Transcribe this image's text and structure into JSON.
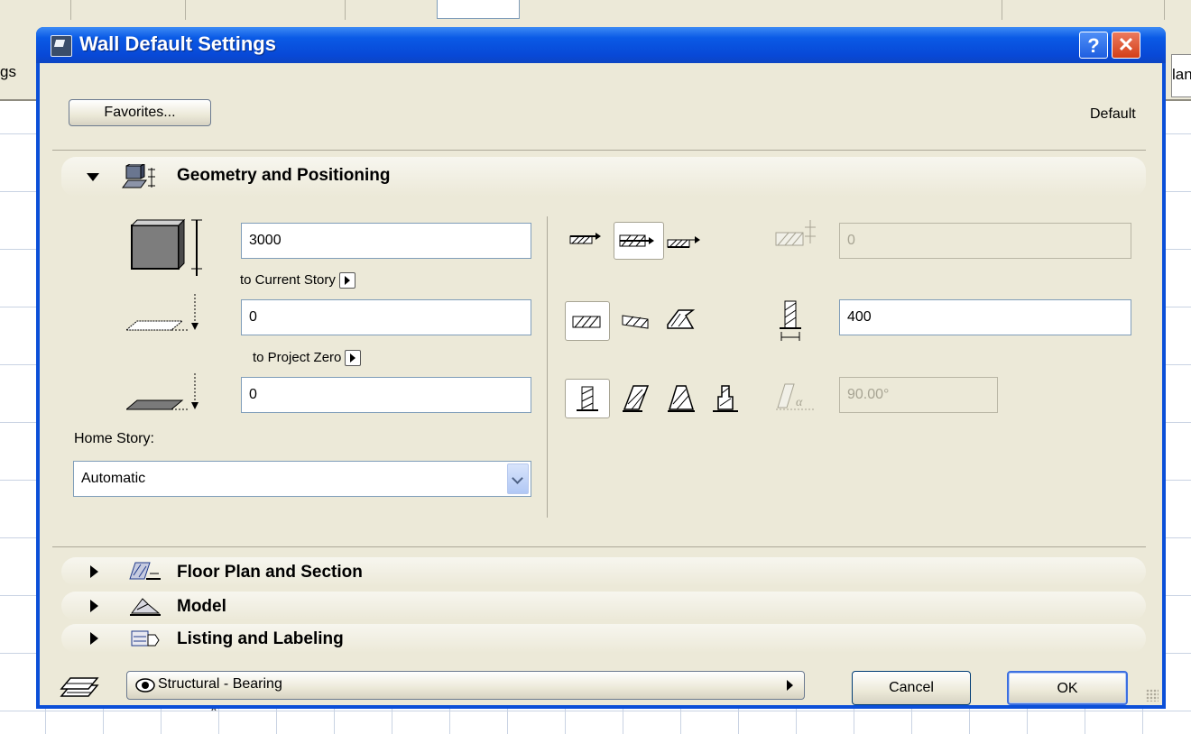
{
  "background": {
    "left_fragment": "gs",
    "right_fragment": "lan"
  },
  "dialog": {
    "title": "Wall Default Settings",
    "help_label": "?",
    "close_label": "✕",
    "favorites_label": "Favorites...",
    "default_label": "Default"
  },
  "geometry": {
    "title": "Geometry and Positioning",
    "height_value": "3000",
    "top_link_label": "to Current Story",
    "bottom_offset_value": "0",
    "reference_label": "to Project Zero",
    "project_zero_value": "0",
    "home_story_label": "Home Story:",
    "home_story_value": "Automatic",
    "offset_value": "0",
    "thickness_value": "400",
    "angle_value": "90.00°"
  },
  "sections": {
    "floor_plan": "Floor Plan and Section",
    "model": "Model",
    "listing": "Listing and Labeling"
  },
  "footer": {
    "layer_value": "Structural - Bearing",
    "cancel_label": "Cancel",
    "ok_label": "OK"
  }
}
